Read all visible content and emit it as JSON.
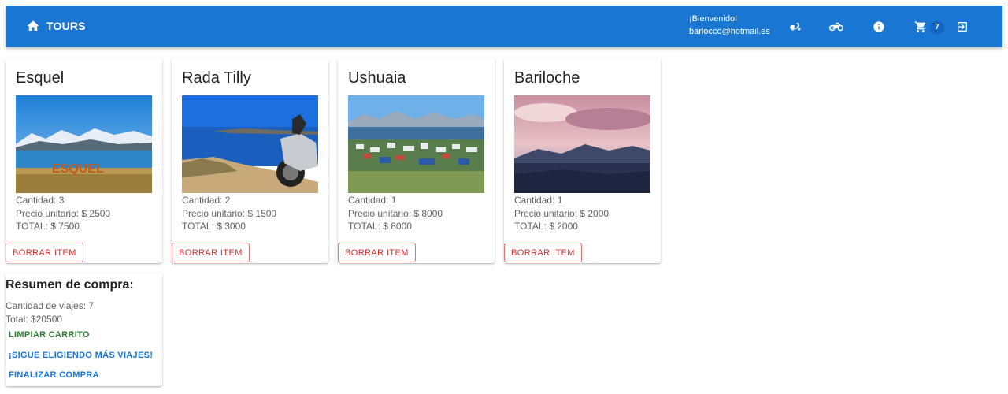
{
  "header": {
    "home_label": "TOURS",
    "welcome": "¡Bienvenido!",
    "email": "barlocco@hotmail.es",
    "cart_count": "7",
    "icons": [
      "scooter-icon",
      "motorcycle-icon",
      "info-icon",
      "cart-icon",
      "logout-icon"
    ],
    "colors": {
      "appbar": "#1976d2",
      "badge": "#1565c0"
    }
  },
  "cards": [
    {
      "title": "Esquel",
      "quantity": "Cantidad: 3",
      "unit_price": "Precio unitario: $ 2500",
      "total": "TOTAL: $ 7500",
      "delete_label": "BORRAR ITEM",
      "image_text": "ESQUEL"
    },
    {
      "title": "Rada Tilly",
      "quantity": "Cantidad: 2",
      "unit_price": "Precio unitario: $ 1500",
      "total": "TOTAL: $ 3000",
      "delete_label": "BORRAR ITEM"
    },
    {
      "title": "Ushuaia",
      "quantity": "Cantidad: 1",
      "unit_price": "Precio unitario: $ 8000",
      "total": "TOTAL: $ 8000",
      "delete_label": "BORRAR ITEM"
    },
    {
      "title": "Bariloche",
      "quantity": "Cantidad: 1",
      "unit_price": "Precio unitario: $ 2000",
      "total": "TOTAL: $ 2000",
      "delete_label": "BORRAR ITEM"
    }
  ],
  "summary": {
    "title": "Resumen de compra:",
    "trip_count": "Cantidad de viajes: 7",
    "total": "Total: $20500",
    "clear_label": "LIMPIAR CARRITO",
    "continue_label": "¡SIGUE ELIGIENDO MÁS VIAJES!",
    "checkout_label": "FINALIZAR COMPRA",
    "colors": {
      "clear": "#2e7d32",
      "continue": "#1976d2",
      "checkout": "#1976d2",
      "delete": "#d32f2f"
    }
  }
}
